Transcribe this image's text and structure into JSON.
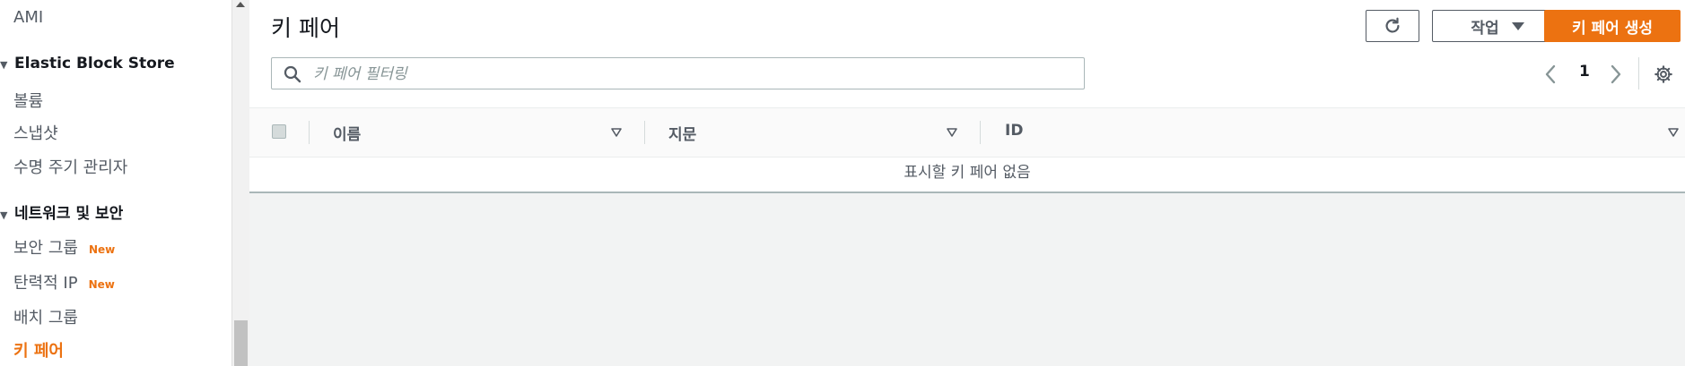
{
  "sidebar": {
    "items": [
      {
        "label": "AMI"
      },
      {
        "label": "Elastic Block Store"
      },
      {
        "label": "볼륨"
      },
      {
        "label": "스냅샷"
      },
      {
        "label": "수명 주기 관리자"
      },
      {
        "label": "네트워크 및 보안"
      },
      {
        "label": "보안 그룹",
        "badge": "New"
      },
      {
        "label": "탄력적 IP",
        "badge": "New"
      },
      {
        "label": "배치 그룹"
      },
      {
        "label": "키 페어"
      }
    ]
  },
  "header": {
    "title": "키 페어",
    "actions_label": "작업",
    "create_label": "키 페어 생성"
  },
  "search": {
    "placeholder": "키 페어 필터링",
    "value": ""
  },
  "pagination": {
    "current_page": "1"
  },
  "table": {
    "columns": [
      "이름",
      "지문",
      "ID"
    ],
    "empty_message": "표시할 키 페어 없음"
  },
  "colors": {
    "accent": "#ec7211",
    "text": "#16191f",
    "secondary_text": "#545b64",
    "background": "#f2f3f3"
  }
}
